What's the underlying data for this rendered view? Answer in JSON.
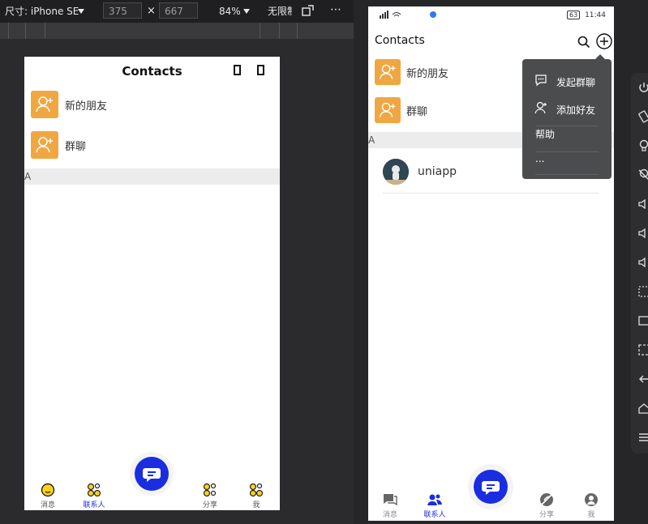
{
  "devtools": {
    "size_label": "尺寸: iPhone SE",
    "width_value": "375",
    "times": "×",
    "height_value": "667",
    "zoom": "84%",
    "throttle": "无限制",
    "more": "⋯"
  },
  "sim": {
    "title": "Contacts",
    "rows": [
      {
        "label": "新的朋友"
      },
      {
        "label": "群聊"
      }
    ],
    "section": "A",
    "tabs": [
      {
        "label": "消息"
      },
      {
        "label": "联系人"
      },
      {
        "label": "分享"
      },
      {
        "label": "我"
      }
    ]
  },
  "device": {
    "status_right": "11:44",
    "battery": "63",
    "title": "Contacts",
    "rows": [
      {
        "label": "新的朋友"
      },
      {
        "label": "群聊"
      }
    ],
    "section": "A",
    "contact": {
      "name": "uniapp"
    },
    "menu": {
      "items": [
        "发起群聊",
        "添加好友",
        "帮助",
        "..."
      ]
    },
    "tabs": [
      {
        "label": "消息"
      },
      {
        "label": "联系人"
      },
      {
        "label": "分享"
      },
      {
        "label": "我"
      }
    ]
  },
  "colors": {
    "accent": "#1a2de0",
    "avatar": "#f0a742",
    "tab_active": "#1a2de0"
  }
}
